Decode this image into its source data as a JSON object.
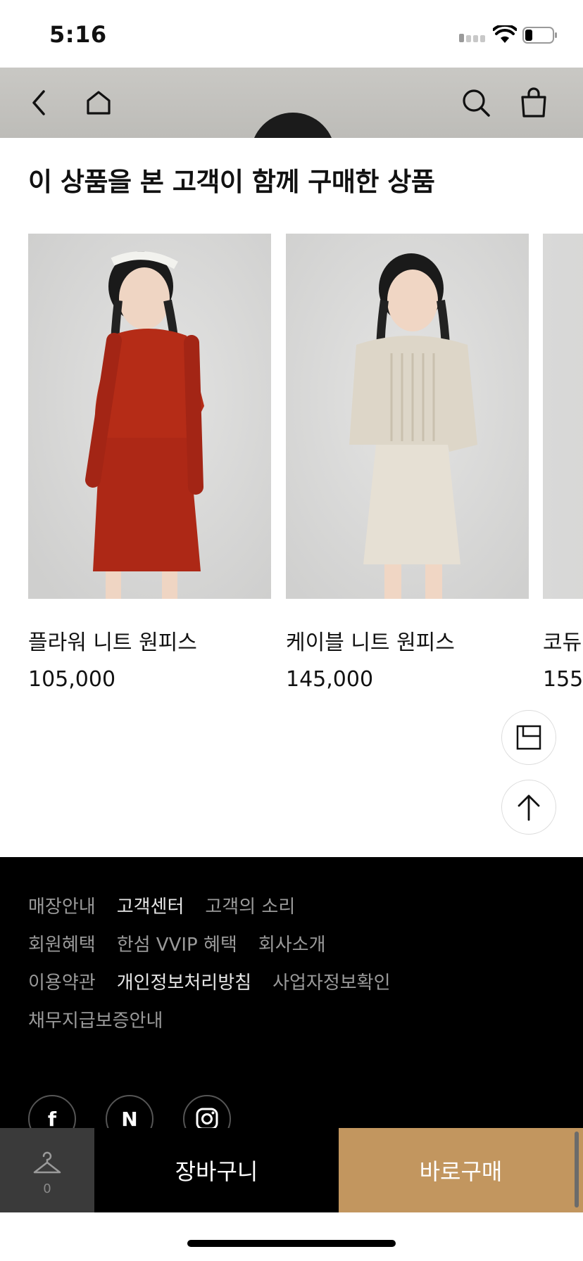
{
  "status_bar": {
    "time": "5:16"
  },
  "section": {
    "title": "이 상품을 본 고객이 함께 구매한 상품"
  },
  "products": [
    {
      "name": "플라워 니트 원피스",
      "price": "105,000"
    },
    {
      "name": "케이블 니트 원피스",
      "price": "145,000"
    },
    {
      "name": "코듀",
      "price": "155,"
    }
  ],
  "footer": {
    "links_row1": [
      "매장안내",
      "고객센터",
      "고객의 소리"
    ],
    "links_row2": [
      "회원혜택",
      "한섬 VVIP 혜택",
      "회사소개"
    ],
    "links_row3": [
      "이용약관",
      "개인정보처리방침",
      "사업자정보확인"
    ],
    "links_row4": [
      "채무지급보증안내"
    ],
    "social": [
      {
        "label": "f",
        "icon": "facebook-icon"
      },
      {
        "label": "N",
        "icon": "naver-icon"
      },
      {
        "icon": "instagram-icon"
      }
    ]
  },
  "action_bar": {
    "wish_count": "0",
    "cart_label": "장바구니",
    "buy_label": "바로구매",
    "colors": {
      "wish_bg": "#3a3a3a",
      "cart_bg": "#000000",
      "buy_bg": "#c2965f"
    }
  },
  "icons": [
    "back-icon",
    "home-icon",
    "search-icon",
    "shopping-bag-icon",
    "recent-view-icon",
    "arrow-up-icon",
    "hanger-icon"
  ]
}
